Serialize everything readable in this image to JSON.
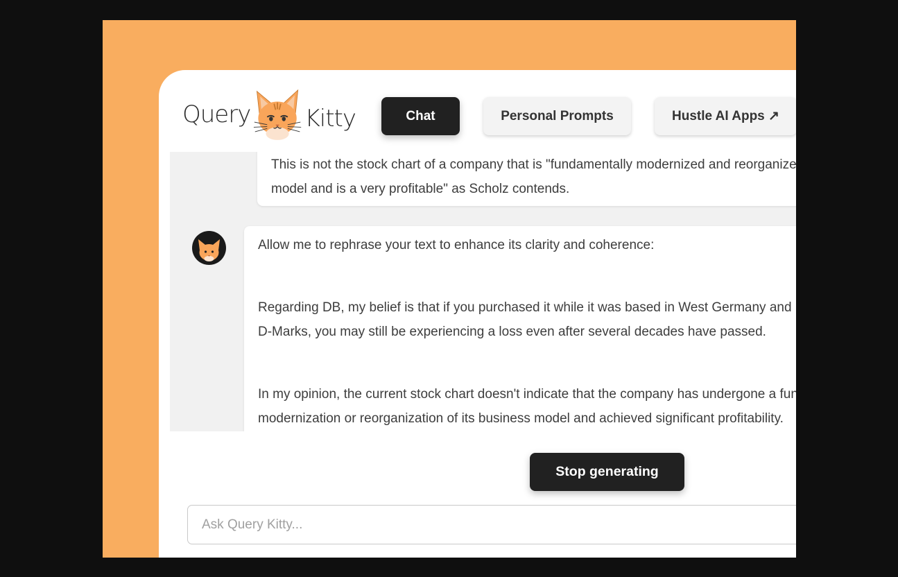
{
  "colors": {
    "backdrop": "#0f0f0f",
    "frame": "#f9ad5f",
    "accent_dark": "#212121",
    "chat_bg": "#f1f1f1"
  },
  "logo": {
    "left_word": "Query",
    "right_word": "Kitty",
    "mascot_icon": "cat-face-icon"
  },
  "nav": {
    "chat": "Chat",
    "personal_prompts": "Personal Prompts",
    "hustle_ai_apps": "Hustle AI Apps ↗"
  },
  "messages": {
    "user": {
      "lines": [
        "This is not the stock chart of a company that is \"fundamentally modernized and reorganized its business",
        "model and is a very profitable\" as Scholz contends."
      ]
    },
    "assistant": {
      "avatar_icon": "cat-avatar-icon",
      "p1": "Allow me to rephrase your text to enhance its clarity and coherence:",
      "p2_lines": [
        "Regarding DB, my belief is that if you purchased it while it was based in West Germany and priced in",
        "D-Marks, you may still be experiencing a loss even after several decades have passed."
      ],
      "p3_lines": [
        "In my opinion, the current stock chart doesn't indicate that the company has undergone a fundamental",
        "modernization or reorganization of its business model and achieved significant profitability."
      ]
    }
  },
  "stop_button": "Stop generating",
  "input": {
    "placeholder": "Ask Query Kitty...",
    "value": ""
  }
}
